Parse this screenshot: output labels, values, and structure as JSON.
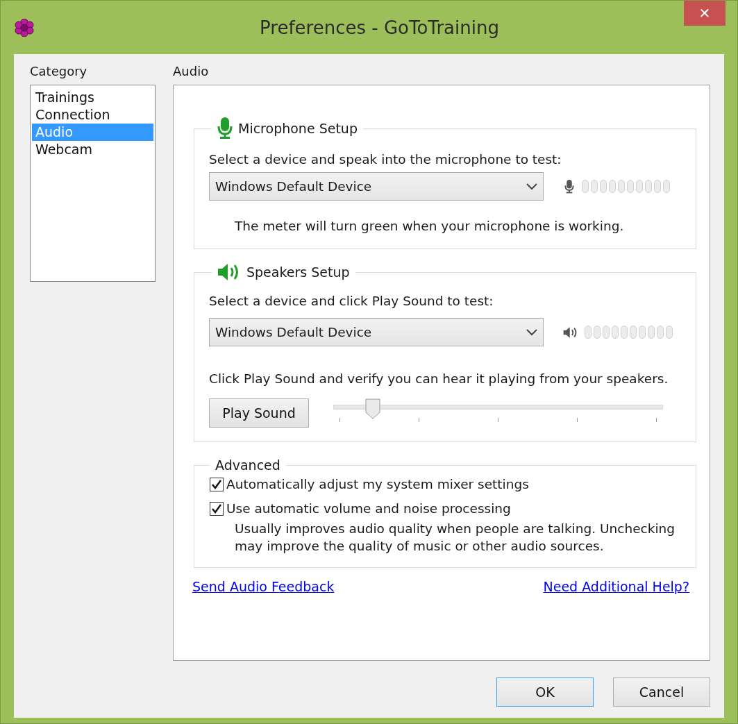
{
  "window": {
    "title": "Preferences - GoToTraining",
    "close": "✕"
  },
  "category": {
    "label": "Category",
    "items": [
      {
        "label": "Trainings",
        "selected": false
      },
      {
        "label": "Connection",
        "selected": false
      },
      {
        "label": "Audio",
        "selected": true
      },
      {
        "label": "Webcam",
        "selected": false
      }
    ]
  },
  "panel": {
    "title": "Audio",
    "microphone": {
      "title": "Microphone Setup",
      "prompt": "Select a device and speak into the microphone to test:",
      "device": "Windows Default Device",
      "note": "The meter will turn green when your microphone is working."
    },
    "speakers": {
      "title": "Speakers Setup",
      "prompt": "Select a device and click Play Sound to test:",
      "device": "Windows Default Device",
      "note": "Click Play Sound and verify you can hear it playing from your speakers.",
      "play_button": "Play Sound",
      "volume": {
        "level": 0.12
      }
    },
    "advanced": {
      "title": "Advanced",
      "options": [
        {
          "label": "Automatically adjust my system mixer settings",
          "checked": true
        },
        {
          "label": "Use automatic volume and noise processing",
          "checked": true
        }
      ],
      "note": "Usually improves audio quality when people are talking. Unchecking may improve the quality of music or other audio sources."
    },
    "links": [
      "Send Audio Feedback",
      "Need Additional Help?"
    ]
  },
  "buttons": [
    {
      "label": "OK",
      "default": true
    },
    {
      "label": "Cancel",
      "default": false
    }
  ]
}
